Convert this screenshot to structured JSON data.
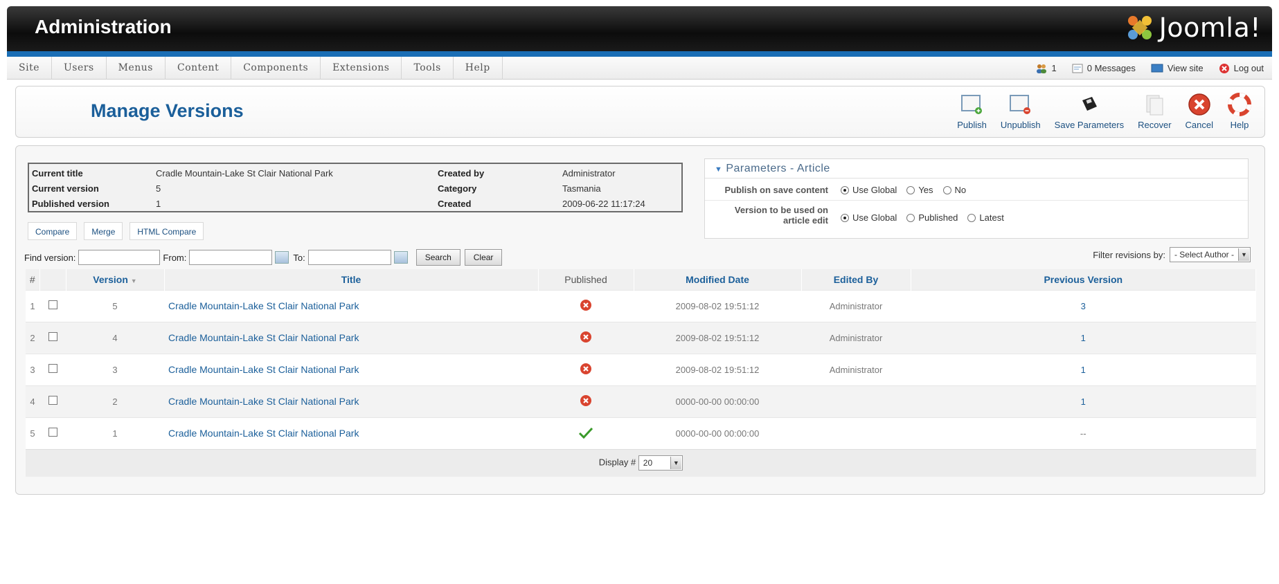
{
  "header": {
    "title": "Administration",
    "brand": "Joomla!"
  },
  "menu": [
    "Site",
    "Users",
    "Menus",
    "Content",
    "Components",
    "Extensions",
    "Tools",
    "Help"
  ],
  "status": {
    "users_count": "1",
    "messages": "0 Messages",
    "view_site": "View site",
    "logout": "Log out"
  },
  "page_title": "Manage Versions",
  "toolbar": [
    {
      "label": "Publish",
      "icon": "publish-icon"
    },
    {
      "label": "Unpublish",
      "icon": "unpublish-icon"
    },
    {
      "label": "Save Parameters",
      "icon": "save-icon"
    },
    {
      "label": "Recover",
      "icon": "recover-icon"
    },
    {
      "label": "Cancel",
      "icon": "cancel-icon"
    },
    {
      "label": "Help",
      "icon": "help-icon"
    }
  ],
  "info": {
    "current_title_label": "Current title",
    "current_title": "Cradle Mountain-Lake St Clair National Park",
    "current_version_label": "Current version",
    "current_version": "5",
    "published_version_label": "Published version",
    "published_version": "1",
    "created_by_label": "Created by",
    "created_by": "Administrator",
    "category_label": "Category",
    "category": "Tasmania",
    "created_label": "Created",
    "created": "2009-06-22 11:17:24"
  },
  "params": {
    "title": "Parameters - Article",
    "row1_label": "Publish on save content",
    "row1_options": [
      "Use Global",
      "Yes",
      "No"
    ],
    "row2_label_1": "Version to be used on",
    "row2_label_2": "article edit",
    "row2_options": [
      "Use Global",
      "Published",
      "Latest"
    ]
  },
  "compare_buttons": [
    "Compare",
    "Merge",
    "HTML Compare"
  ],
  "search": {
    "find_label": "Find version:",
    "from_label": "From:",
    "to_label": "To:",
    "search_btn": "Search",
    "clear_btn": "Clear",
    "filter_label": "Filter revisions by:",
    "filter_value": "- Select Author -"
  },
  "table": {
    "columns": [
      "#",
      "Version",
      "Title",
      "Published",
      "Modified Date",
      "Edited By",
      "Previous Version"
    ],
    "rows": [
      {
        "num": "1",
        "version": "5",
        "title": "Cradle Mountain-Lake St Clair National Park",
        "published": false,
        "modified": "2009-08-02 19:51:12",
        "edited_by": "Administrator",
        "previous": "3"
      },
      {
        "num": "2",
        "version": "4",
        "title": "Cradle Mountain-Lake St Clair National Park",
        "published": false,
        "modified": "2009-08-02 19:51:12",
        "edited_by": "Administrator",
        "previous": "1"
      },
      {
        "num": "3",
        "version": "3",
        "title": "Cradle Mountain-Lake St Clair National Park",
        "published": false,
        "modified": "2009-08-02 19:51:12",
        "edited_by": "Administrator",
        "previous": "1"
      },
      {
        "num": "4",
        "version": "2",
        "title": "Cradle Mountain-Lake St Clair National Park",
        "published": false,
        "modified": "0000-00-00 00:00:00",
        "edited_by": "",
        "previous": "1"
      },
      {
        "num": "5",
        "version": "1",
        "title": "Cradle Mountain-Lake St Clair National Park",
        "published": true,
        "modified": "0000-00-00 00:00:00",
        "edited_by": "",
        "previous": "--"
      }
    ],
    "display_label": "Display #",
    "display_value": "20"
  },
  "colors": {
    "accent_blue": "#1b5f9a",
    "bar_blue": "#1a6eb5",
    "unpublished_red": "#d9442f",
    "published_green": "#3a9a2a"
  }
}
